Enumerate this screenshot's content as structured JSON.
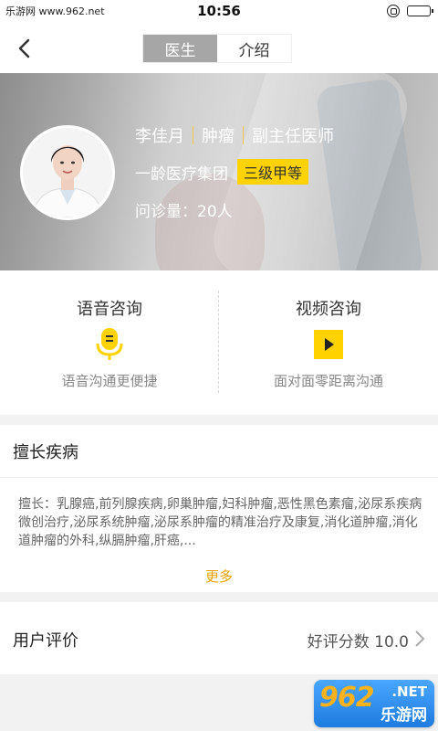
{
  "status_bar": {
    "watermark_site": "乐游网 www.962.net",
    "time": "10:56"
  },
  "nav": {
    "tabs": [
      {
        "label": "医生",
        "active": true
      },
      {
        "label": "介绍",
        "active": false
      }
    ]
  },
  "doctor": {
    "name": "李佳月",
    "department": "肿瘤",
    "title": "副主任医师",
    "hospital": "一龄医疗集团",
    "grade": "三级甲等",
    "visits_label": "问诊量：20人"
  },
  "consult": {
    "voice": {
      "title": "语音咨询",
      "subtitle": "语音沟通更便捷",
      "icon": "microphone-icon"
    },
    "video": {
      "title": "视频咨询",
      "subtitle": "面对面零距离沟通",
      "icon": "play-icon"
    }
  },
  "specialty": {
    "heading": "擅长疾病",
    "text": "擅长：乳腺癌,前列腺疾病,卵巢肿瘤,妇科肿瘤,恶性黑色素瘤,泌尿系疾病微创治疗,泌尿系统肿瘤,泌尿系肿瘤的精准治疗及康复,消化道肿瘤,消化道肿瘤的外科,纵膈肿瘤,肝癌,...",
    "more_label": "更多"
  },
  "rating": {
    "label": "用户评价",
    "value": "好评分数 10.0"
  },
  "watermark": {
    "logo_number": "962",
    "logo_net": ".NET",
    "logo_cn": "乐游网"
  },
  "colors": {
    "accent_yellow": "#ffd200",
    "more_link": "#e8a100",
    "tab_active_bg": "#a6a6a6"
  }
}
